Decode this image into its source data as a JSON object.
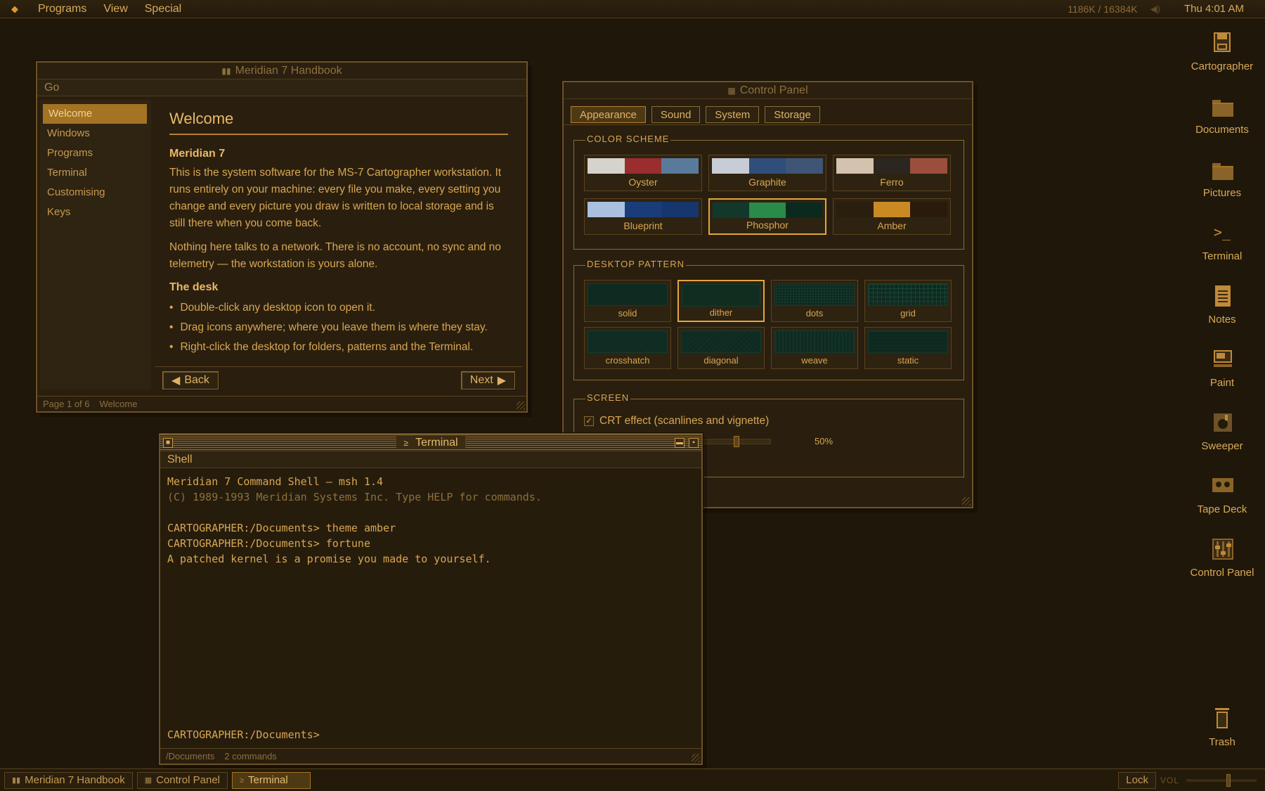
{
  "menubar": {
    "items": [
      "Programs",
      "View",
      "Special"
    ],
    "memory": "1186K / 16384K",
    "clock": "Thu 4:01 AM"
  },
  "handbook": {
    "title": "Meridian 7 Handbook",
    "go_label": "Go",
    "nav": [
      "Welcome",
      "Windows",
      "Programs",
      "Terminal",
      "Customising",
      "Keys"
    ],
    "selected_nav": "Welcome",
    "heading": "Welcome",
    "subheading": "Meridian 7",
    "para1": "This is the system software for the MS-7 Cartographer workstation. It runs entirely on your machine: every file you make, every setting you change and every picture you draw is written to local storage and is still there when you come back.",
    "para2": "Nothing here talks to a network. There is no account, no sync and no telemetry — the workstation is yours alone.",
    "section2": "The desk",
    "bullets": [
      "Double-click any desktop icon to open it.",
      "Drag icons anywhere; where you leave them is where they stay.",
      "Right-click the desktop for folders, patterns and the Terminal."
    ],
    "back_label": "Back",
    "next_label": "Next",
    "status_page": "Page 1 of 6",
    "status_section": "Welcome"
  },
  "control_panel": {
    "title": "Control Panel",
    "tabs": [
      "Appearance",
      "Sound",
      "System",
      "Storage"
    ],
    "selected_tab": "Appearance",
    "color_scheme_label": "COLOR SCHEME",
    "schemes": [
      {
        "name": "Oyster",
        "colors": [
          "#d6d3cc",
          "#9a2d2d",
          "#5a7a9c"
        ]
      },
      {
        "name": "Graphite",
        "colors": [
          "#c7ccd6",
          "#2f4f7a",
          "#3e5575"
        ]
      },
      {
        "name": "Ferro",
        "colors": [
          "#d3c2ad",
          "#2c2620",
          "#9c4e3c"
        ]
      },
      {
        "name": "Blueprint",
        "colors": [
          "#aac0de",
          "#1a3d7a",
          "#16366d"
        ]
      },
      {
        "name": "Phosphor",
        "colors": [
          "#12382b",
          "#2a8a4a",
          "#0b2a1f"
        ]
      },
      {
        "name": "Amber",
        "colors": [
          "#2a1f0e",
          "#c98a24",
          "#2a1a0c"
        ]
      }
    ],
    "selected_scheme": "Phosphor",
    "pattern_label": "DESKTOP PATTERN",
    "patterns": [
      "solid",
      "dither",
      "dots",
      "grid",
      "crosshatch",
      "diagonal",
      "weave",
      "static"
    ],
    "selected_pattern": "dither",
    "screen_label": "SCREEN",
    "crt_label": "CRT effect (scanlines and vignette)",
    "crt_checked": true,
    "crt_check_mark": "✓",
    "slider_value": 0.5,
    "slider_readout": "50%"
  },
  "terminal": {
    "title": "Terminal",
    "shell_label": "Shell",
    "lines": [
      {
        "text": "Meridian 7 Command Shell — msh 1.4",
        "dim": false
      },
      {
        "text": "(C) 1989-1993 Meridian Systems Inc.   Type HELP for commands.",
        "dim": true
      },
      {
        "text": "",
        "dim": false
      },
      {
        "text": "CARTOGRAPHER:/Documents> theme amber",
        "dim": false
      },
      {
        "text": "CARTOGRAPHER:/Documents> fortune",
        "dim": false
      },
      {
        "text": "A patched kernel is a promise you made to yourself.",
        "dim": false
      }
    ],
    "prompt": "CARTOGRAPHER:/Documents>",
    "status_path": "/Documents",
    "status_count": "2 commands"
  },
  "desktop_icons": [
    {
      "label": "Cartographer",
      "icon": "floppy-icon"
    },
    {
      "label": "Documents",
      "icon": "folder-icon"
    },
    {
      "label": "Pictures",
      "icon": "folder-icon"
    },
    {
      "label": "Terminal",
      "icon": "terminal-icon"
    },
    {
      "label": "Notes",
      "icon": "notes-icon"
    },
    {
      "label": "Paint",
      "icon": "paint-icon"
    },
    {
      "label": "Sweeper",
      "icon": "sweeper-icon"
    },
    {
      "label": "Tape Deck",
      "icon": "tape-icon"
    },
    {
      "label": "Control Panel",
      "icon": "control-panel-icon"
    }
  ],
  "trash": {
    "label": "Trash"
  },
  "taskbar": {
    "tasks": [
      "Meridian 7 Handbook",
      "Control Panel",
      "Terminal"
    ],
    "active_task": "Terminal",
    "lock_label": "Lock",
    "vol_label": "VOL",
    "volume": 0.6
  },
  "colors": {
    "accent": "#e3a640",
    "text": "#d8a652",
    "background": "#1f1709"
  }
}
